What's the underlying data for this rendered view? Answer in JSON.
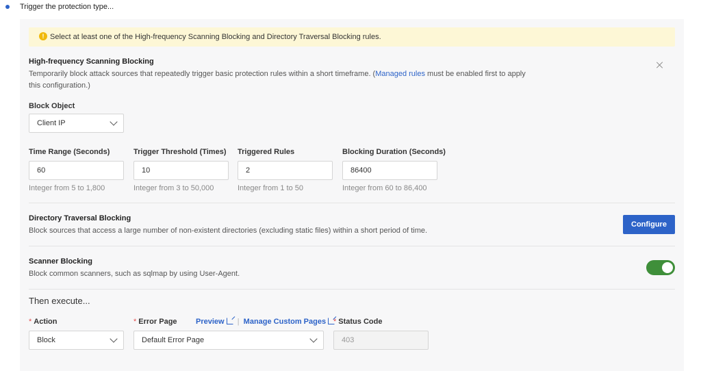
{
  "step": {
    "title": "Trigger the protection type..."
  },
  "alert": {
    "text": "Select at least one of the High-frequency Scanning Blocking and Directory Traversal Blocking rules."
  },
  "high_freq": {
    "title": "High-frequency Scanning Blocking",
    "desc_before": "Temporarily block attack sources that repeatedly trigger basic protection rules within a short timeframe. (",
    "desc_link": "Managed rules",
    "desc_after": " must be enabled first to apply this configuration.)",
    "block_object": {
      "label": "Block Object",
      "value": "Client IP"
    },
    "fields": [
      {
        "label": "Time Range (Seconds)",
        "value": "60",
        "hint": "Integer from 5 to 1,800"
      },
      {
        "label": "Trigger Threshold (Times)",
        "value": "10",
        "hint": "Integer from 3 to 50,000"
      },
      {
        "label": "Triggered Rules",
        "value": "2",
        "hint": "Integer from 1 to 50"
      },
      {
        "label": "Blocking Duration (Seconds)",
        "value": "86400",
        "hint": "Integer from 60 to 86,400"
      }
    ]
  },
  "dir_traversal": {
    "title": "Directory Traversal Blocking",
    "desc": "Block sources that access a large number of non-existent directories (excluding static files) within a short period of time.",
    "configure_label": "Configure"
  },
  "scanner": {
    "title": "Scanner Blocking",
    "desc": "Block common scanners, such as sqlmap by using User-Agent.",
    "enabled": true
  },
  "then": {
    "title": "Then execute...",
    "action": {
      "label": "Action",
      "value": "Block"
    },
    "error_page": {
      "label": "Error Page",
      "preview": "Preview",
      "manage": "Manage Custom Pages",
      "value": "Default Error Page"
    },
    "status_code": {
      "label": "Status Code",
      "value": "403"
    }
  },
  "icons": {
    "alert": "warning-icon",
    "close": "close-icon",
    "external": "external-link-icon",
    "chevron": "chevron-down-icon"
  },
  "colors": {
    "accent": "#2d63c8",
    "toggle_on": "#3f8f3a",
    "warning": "#f0b90b",
    "required": "#e34c4c"
  }
}
